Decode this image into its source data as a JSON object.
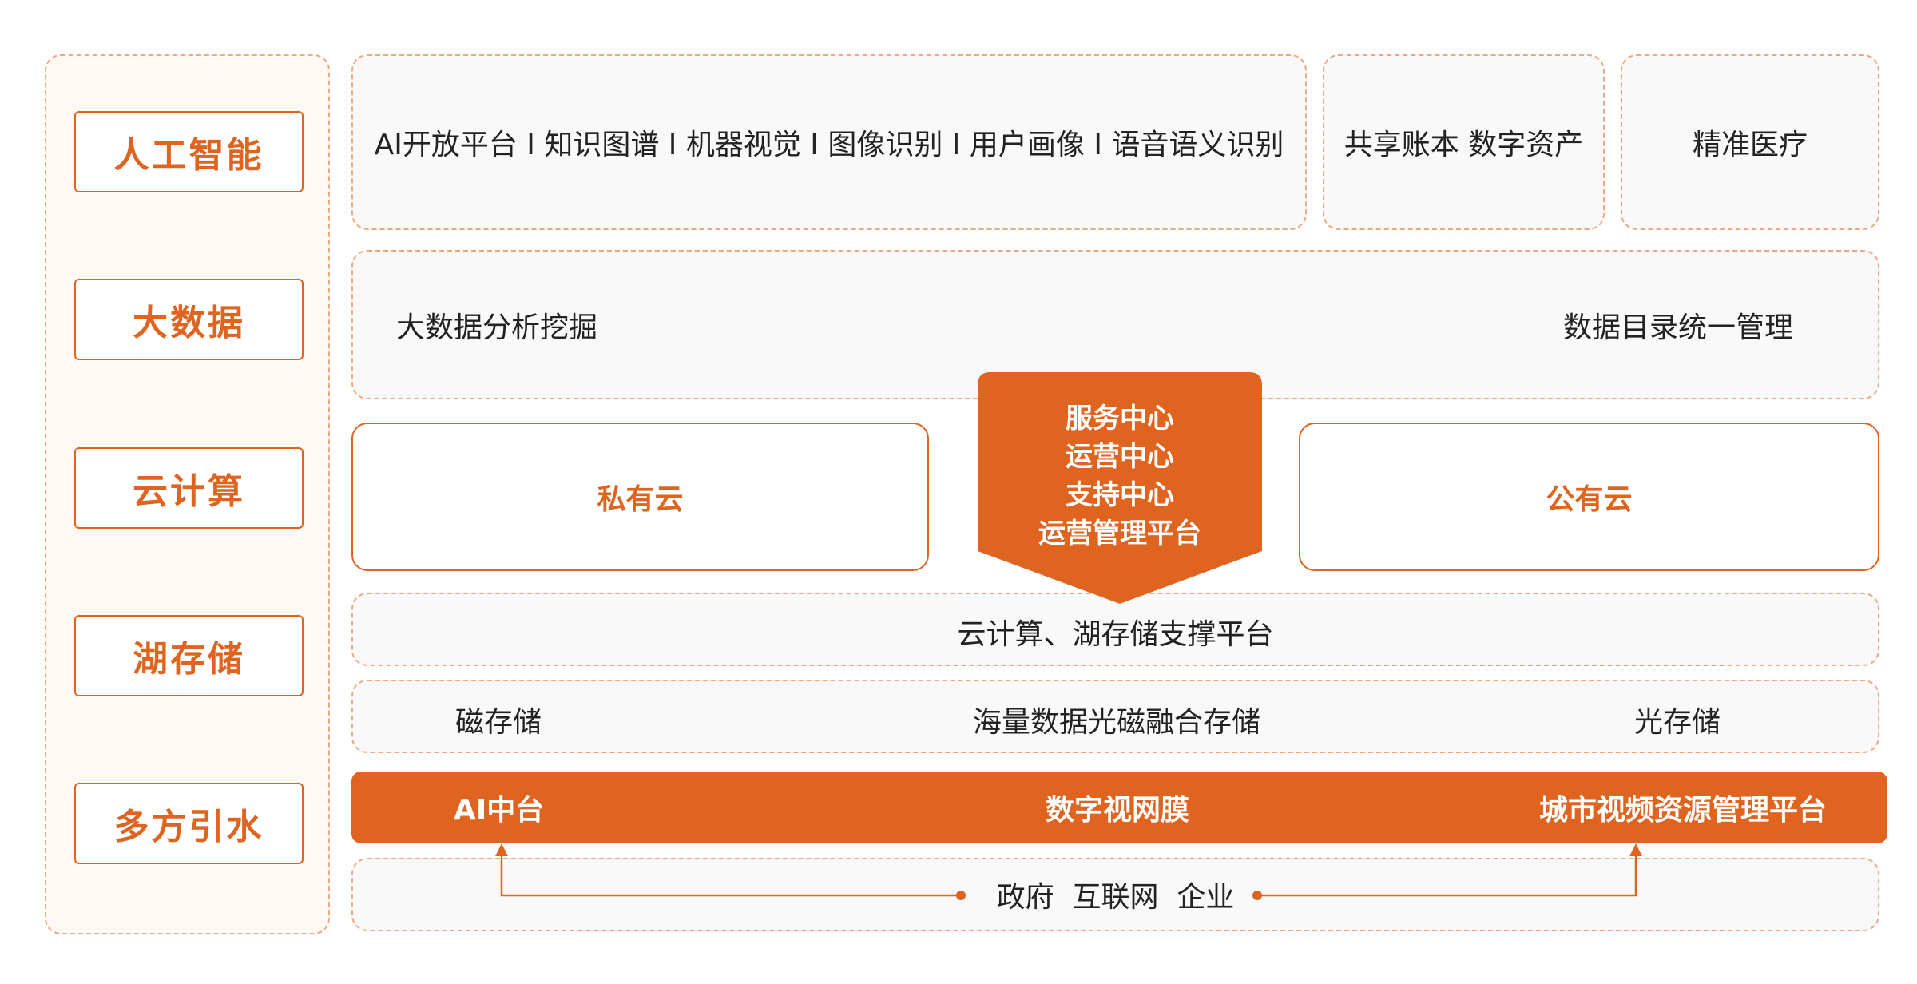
{
  "categories": [
    "人工智能",
    "大数据",
    "云计算",
    "湖存储",
    "多方引水"
  ],
  "ai_row": {
    "main": "AI开放平台 I 知识图谱 I 机器视觉 I 图像识别 I 用户画像 I 语音语义识别",
    "ledger": "共享账本 数字资产",
    "medical": "精准医疗"
  },
  "bigdata_row": {
    "left": "大数据分析挖掘",
    "right": "数据目录统一管理"
  },
  "cloud_row": {
    "private": "私有云",
    "public": "公有云",
    "center": [
      "服务中心",
      "运营中心",
      "支持中心",
      "运营管理平台"
    ]
  },
  "support_platform": "云计算、湖存储支撑平台",
  "storage_row": {
    "left": "磁存储",
    "middle": "海量数据光磁融合存储",
    "right": "光存储"
  },
  "bar": {
    "left": "AI中台",
    "middle": "数字视网膜",
    "right": "城市视频资源管理平台"
  },
  "sources": "政府  互联网  企业",
  "colors": {
    "accent": "#df6420",
    "dashed_border": "#eda882",
    "panel_bg": "#f9f9f9",
    "left_bg": "#fff8f4"
  }
}
